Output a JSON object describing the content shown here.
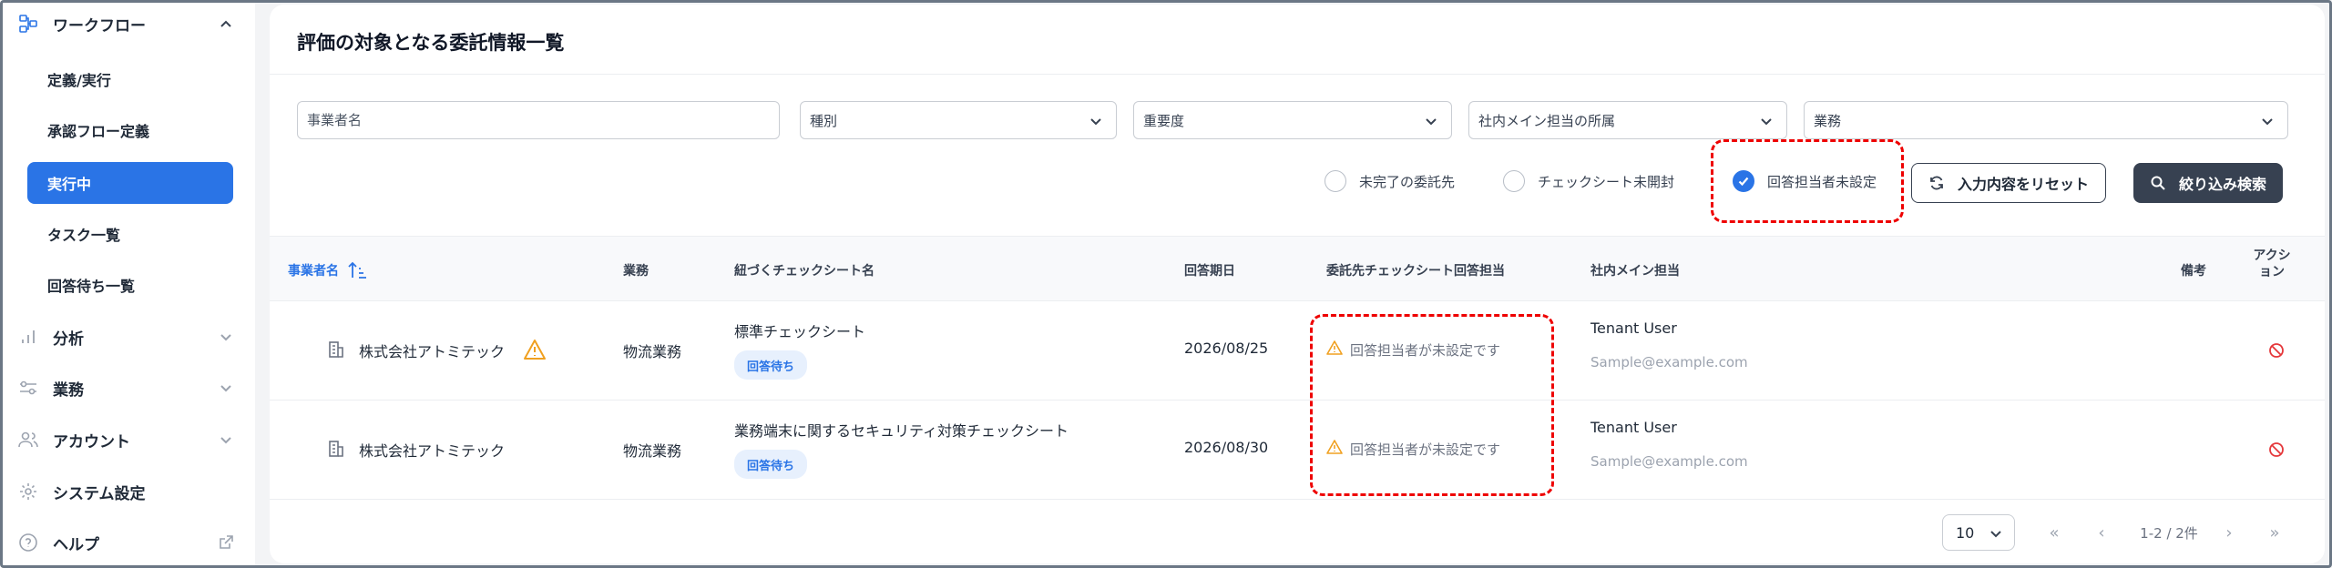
{
  "sidebar": {
    "workflow": {
      "label": "ワークフロー",
      "icon": "workflow-icon"
    },
    "sub_items": [
      {
        "label": "定義/実行"
      },
      {
        "label": "承認フロー定義"
      },
      {
        "label": "実行中",
        "active": true
      },
      {
        "label": "タスク一覧"
      },
      {
        "label": "回答待ち一覧"
      }
    ],
    "analysis": {
      "label": "分析",
      "icon": "bar-chart-icon"
    },
    "business": {
      "label": "業務",
      "icon": "sliders-icon"
    },
    "account": {
      "label": "アカウント",
      "icon": "users-icon"
    },
    "system": {
      "label": "システム設定",
      "icon": "gear-icon"
    },
    "help": {
      "label": "ヘルプ",
      "icon": "help-circle-icon"
    }
  },
  "card": {
    "title": "評価の対象となる委託情報一覧"
  },
  "filters": {
    "business_name_placeholder": "事業者名",
    "type": "種別",
    "importance": "重要度",
    "dept": "社内メイン担当の所属",
    "work": "業務",
    "checks": [
      {
        "label": "未完了の委託先",
        "checked": false
      },
      {
        "label": "チェックシート未開封",
        "checked": false
      },
      {
        "label": "回答担当者未設定",
        "checked": true
      }
    ],
    "reset_label": "入力内容をリセット",
    "search_label": "絞り込み検索"
  },
  "table": {
    "headers": {
      "business": "事業者名",
      "work": "業務",
      "sheet": "紐づくチェックシート名",
      "due": "回答期日",
      "responder": "委託先チェックシート回答担当",
      "owner": "社内メイン担当",
      "note": "備考",
      "action": "アクション"
    },
    "rows": [
      {
        "company": "株式会社アトミテック",
        "work": "物流業務",
        "sheet": "標準チェックシート",
        "tag": "回答待ち",
        "due": "2026/08/25",
        "responder": "回答担当者が未設定です",
        "owner_name": "Tenant User",
        "owner_email": "Sample@example.com"
      },
      {
        "company": "株式会社アトミテック",
        "work": "物流業務",
        "sheet": "業務端末に関するセキュリティ対策チェックシート",
        "tag": "回答待ち",
        "due": "2026/08/30",
        "responder": "回答担当者が未設定です",
        "owner_name": "Tenant User",
        "owner_email": "Sample@example.com"
      }
    ]
  },
  "pagination": {
    "per_page": "10",
    "range": "1-2 / 2件"
  },
  "colors": {
    "accent": "#2a74e6",
    "warning": "#f0a020",
    "danger": "#e5383b",
    "highlight": "#ee0000"
  }
}
